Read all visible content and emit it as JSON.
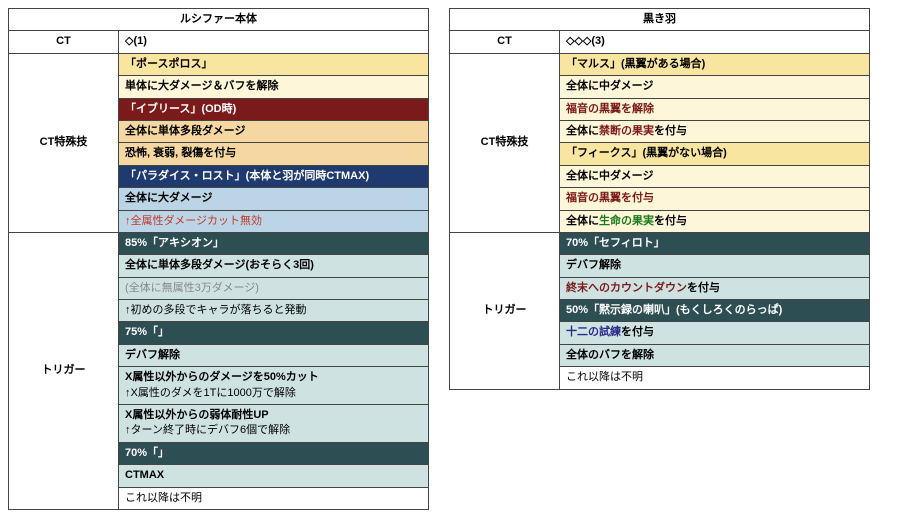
{
  "left": {
    "title": "ルシファー本体",
    "ct_label": "CT",
    "ct_value": "◇(1)",
    "section_ct": "CT特殊技",
    "section_trigger": "トリガー",
    "rows": {
      "r1": "「ポースポロス」",
      "r2": "単体に大ダメージ＆バフを解除",
      "r3": "「イブリース」(OD時)",
      "r4": "全体に単体多段ダメージ",
      "r5": "恐怖, 衰弱, 裂傷を付与",
      "r6": "「パラダイス・ロスト」(本体と羽が同時CTMAX)",
      "r7": "全体に大ダメージ",
      "r8": "↑全属性ダメージカット無効",
      "r9": "85%「アキシオン」",
      "r10": "全体に単体多段ダメージ(おそらく3回)",
      "r11": "(全体に無属性3万ダメージ)",
      "r12": "↑初めの多段でキャラが落ちると発動",
      "r13": "75%「」",
      "r14": "デバフ解除",
      "r15a": "X属性以外からのダメージを50%カット",
      "r15b": "↑X属性のダメを1Tに1000万で解除",
      "r16a": "X属性以外からの弱体耐性UP",
      "r16b": "↑ターン終了時にデバフ6個で解除",
      "r17": "70%「」",
      "r18": "CTMAX",
      "r19": "これ以降は不明"
    }
  },
  "right": {
    "title": "黒き羽",
    "ct_label": "CT",
    "ct_value": "◇◇◇(3)",
    "section_ct": "CT特殊技",
    "section_trigger": "トリガー",
    "rows": {
      "r1": "「マルス」(黒翼がある場合)",
      "r2": "全体に中ダメージ",
      "r3": "福音の黒翼を解除",
      "r4_pre": "全体に",
      "r4_em": "禁断の果実",
      "r4_post": "を付与",
      "r5": "「フィークス」(黒翼がない場合)",
      "r6": "全体に中ダメージ",
      "r7": "福音の黒翼を付与",
      "r8_pre": "全体に",
      "r8_em": "生命の果実",
      "r8_post": "を付与",
      "r9": "70%「セフィロト」",
      "r10": "デバフ解除",
      "r11_em": "終末へのカウントダウン",
      "r11_post": "を付与",
      "r12": "50%「黙示録の喇叭」(もくしろくのらっぱ)",
      "r13_em": "十二の試練",
      "r13_post": "を付与",
      "r14": "全体のバフを解除",
      "r15": "これ以降は不明"
    }
  }
}
